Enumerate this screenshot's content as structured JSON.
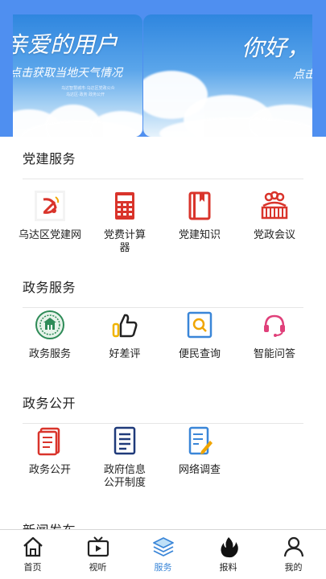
{
  "banner": {
    "slides": [
      {
        "title": "亲爱的用户",
        "subtitle": "点击获取当地天气情况",
        "tiny_lines": [
          "乌达智慧城市·乌达区党政公众",
          "乌达区·政务 政务公开"
        ]
      },
      {
        "title": "你好，",
        "subtitle": "点击"
      }
    ]
  },
  "sections": [
    {
      "title": "党建服务",
      "items": [
        {
          "label": "乌达区党建网",
          "icon": "party-emblem-icon"
        },
        {
          "label": "党费计算器",
          "icon": "calculator-icon"
        },
        {
          "label": "党建知识",
          "icon": "book-icon"
        },
        {
          "label": "党政会议",
          "icon": "meeting-icon"
        }
      ]
    },
    {
      "title": "政务服务",
      "items": [
        {
          "label": "政务服务",
          "icon": "government-seal-icon"
        },
        {
          "label": "好差评",
          "icon": "thumbs-up-icon"
        },
        {
          "label": "便民查询",
          "icon": "search-doc-icon"
        },
        {
          "label": "智能问答",
          "icon": "headset-icon"
        }
      ]
    },
    {
      "title": "政务公开",
      "items": [
        {
          "label": "政务公开",
          "icon": "document-icon"
        },
        {
          "label": "政府信息公开制度",
          "icon": "list-document-icon"
        },
        {
          "label": "网络调查",
          "icon": "edit-document-icon"
        }
      ]
    },
    {
      "title": "新闻发布",
      "items": []
    }
  ],
  "nav": {
    "items": [
      {
        "label": "首页",
        "icon": "home-icon"
      },
      {
        "label": "视听",
        "icon": "video-icon"
      },
      {
        "label": "服务",
        "icon": "layers-icon"
      },
      {
        "label": "报料",
        "icon": "flame-icon"
      },
      {
        "label": "我的",
        "icon": "user-icon"
      }
    ],
    "active_index": 2
  },
  "colors": {
    "banner_blue": "#4f8ff0",
    "party_red": "#d9342b",
    "service_green": "#2e8b57",
    "accent_blue": "#3a86d8",
    "doc_navy": "#1f3a7a"
  }
}
